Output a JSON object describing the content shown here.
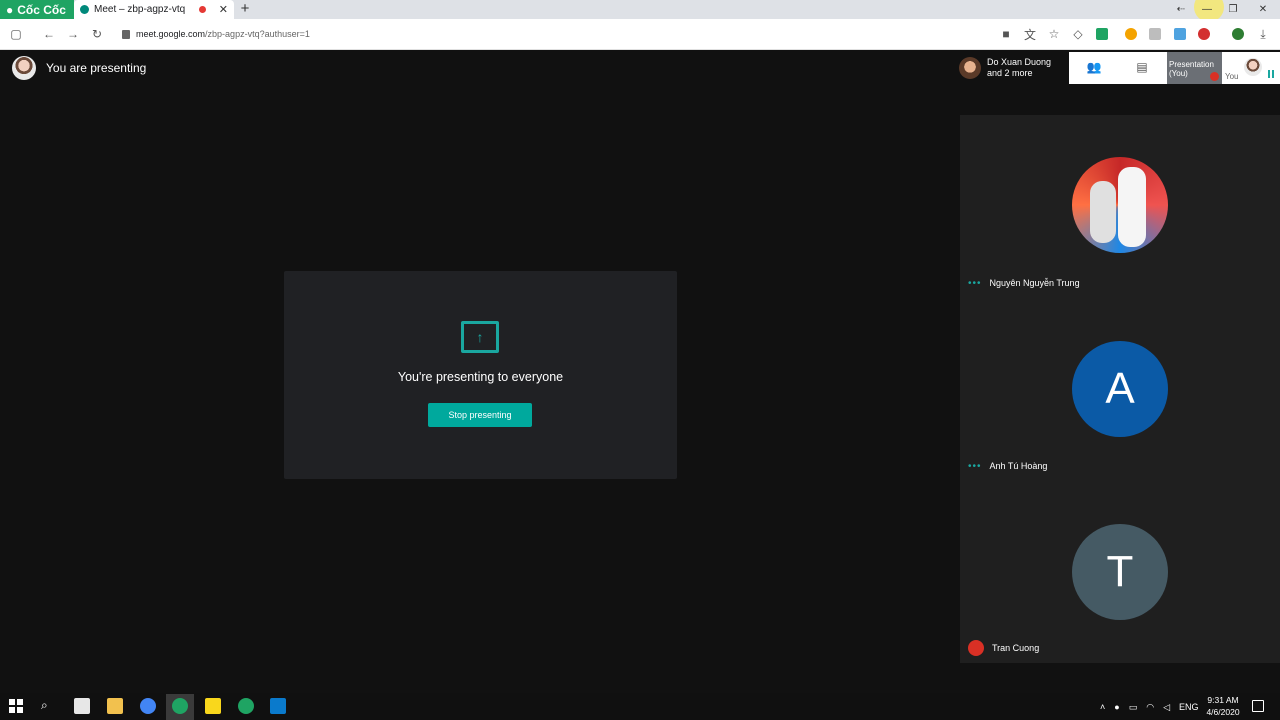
{
  "browser": {
    "brand": "Cốc Cốc",
    "tab_title": "Meet – zbp-agpz-vtq",
    "url_domain": "meet.google.com",
    "url_path": "/zbp-agpz-vtq?authuser=1"
  },
  "meet": {
    "presenting_label": "You are presenting",
    "owner_name": "Do Xuan Duong",
    "owner_more": "and 2 more",
    "presentation_thumb": "Presentation (You)",
    "you_label": "You",
    "card_text": "You're presenting to everyone",
    "stop_button": "Stop presenting",
    "participants": [
      {
        "name": "Nguyên Nguyễn Trung",
        "initial": ""
      },
      {
        "name": "Anh Tú Hoàng",
        "initial": "A"
      },
      {
        "name": "Tran Cuong",
        "initial": "T"
      }
    ]
  },
  "taskbar": {
    "language": "ENG",
    "time": "9:31 AM",
    "date": "4/6/2020"
  },
  "colors": {
    "accent": "#1aa7a0",
    "button": "#00a99d",
    "brand": "#1fa463",
    "mute": "#d93025",
    "avatar_a": "#0b5aa6",
    "avatar_t": "#455a64"
  }
}
